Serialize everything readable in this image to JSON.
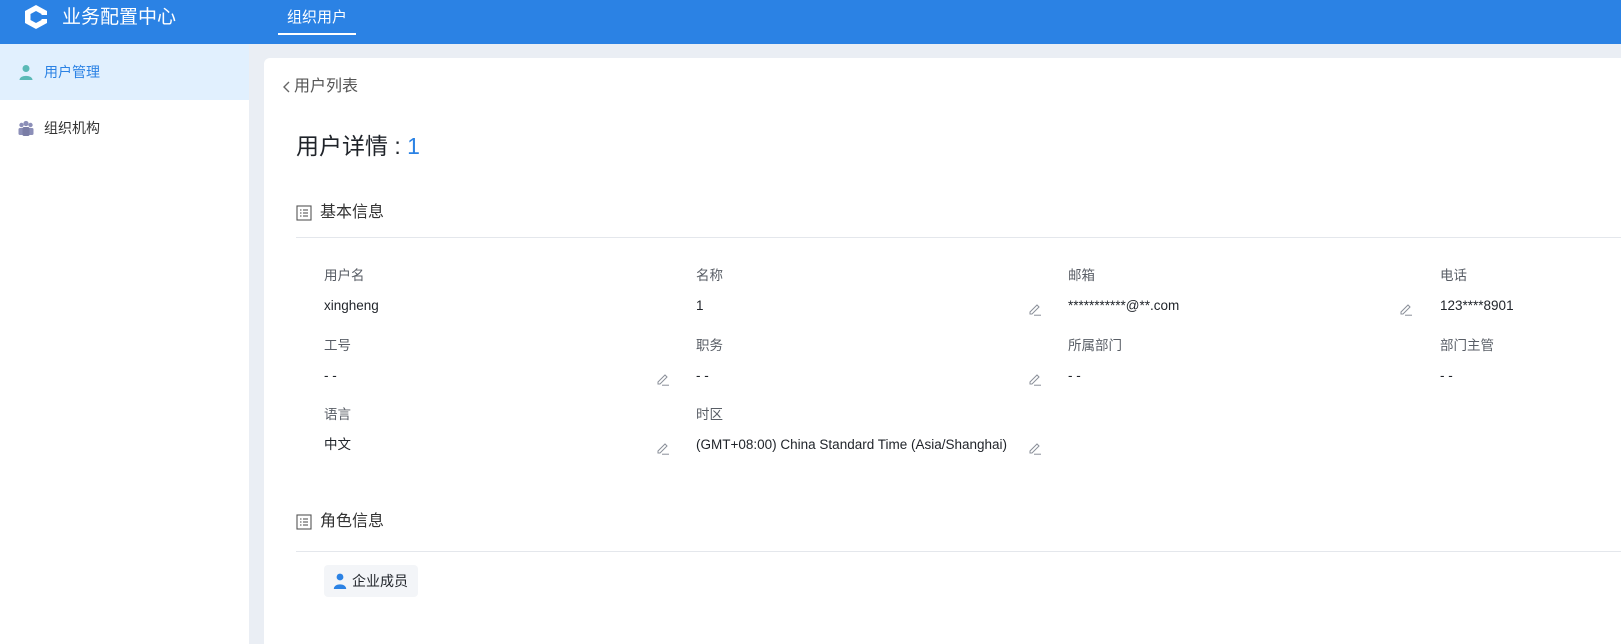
{
  "app": {
    "title": "业务配置中心",
    "top_tab": "组织用户"
  },
  "sidebar": {
    "items": [
      {
        "label": "用户管理",
        "icon": "user-icon",
        "active": true
      },
      {
        "label": "组织机构",
        "icon": "org-icon",
        "active": false
      }
    ]
  },
  "page": {
    "back_label": "用户列表",
    "title_prefix": "用户详情 : ",
    "user_id": "1"
  },
  "basic_info": {
    "section_title": "基本信息",
    "fields": [
      {
        "label": "用户名",
        "value": "xingheng",
        "editable": false
      },
      {
        "label": "名称",
        "value": "1",
        "editable": true
      },
      {
        "label": "邮箱",
        "value": "***********@**.com",
        "editable": true
      },
      {
        "label": "电话",
        "value": "123****8901",
        "editable": false
      },
      {
        "label": "工号",
        "value": "- -",
        "editable": true
      },
      {
        "label": "职务",
        "value": "- -",
        "editable": true
      },
      {
        "label": "所属部门",
        "value": "- -",
        "editable": false
      },
      {
        "label": "部门主管",
        "value": "- -",
        "editable": false
      },
      {
        "label": "语言",
        "value": "中文",
        "editable": true
      },
      {
        "label": "时区",
        "value": "(GMT+08:00) China Standard Time (Asia/Shanghai)",
        "editable": true
      }
    ]
  },
  "role_info": {
    "section_title": "角色信息",
    "roles": [
      "企业成员"
    ]
  },
  "colors": {
    "primary": "#2b82e4",
    "sidebar_active_bg": "#e1f0fe",
    "page_bg": "#eaeef4"
  }
}
